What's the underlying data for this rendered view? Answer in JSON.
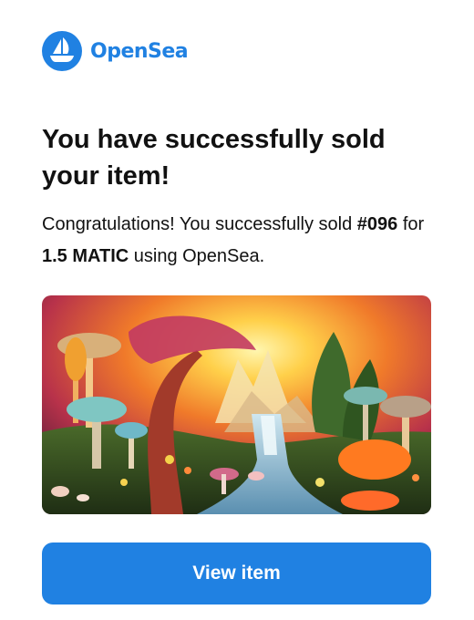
{
  "brand": {
    "name": "OpenSea",
    "color": "#2081E2"
  },
  "headline": "You have successfully sold your item!",
  "message": {
    "prefix": "Congratulations! You successfully sold ",
    "item": "#096",
    "for_text": " for ",
    "price": "1.5 MATIC",
    "suffix": " using OpenSea."
  },
  "image": {
    "icon": "nft-artwork-image"
  },
  "cta": {
    "label": "View item",
    "color": "#2081E2"
  }
}
